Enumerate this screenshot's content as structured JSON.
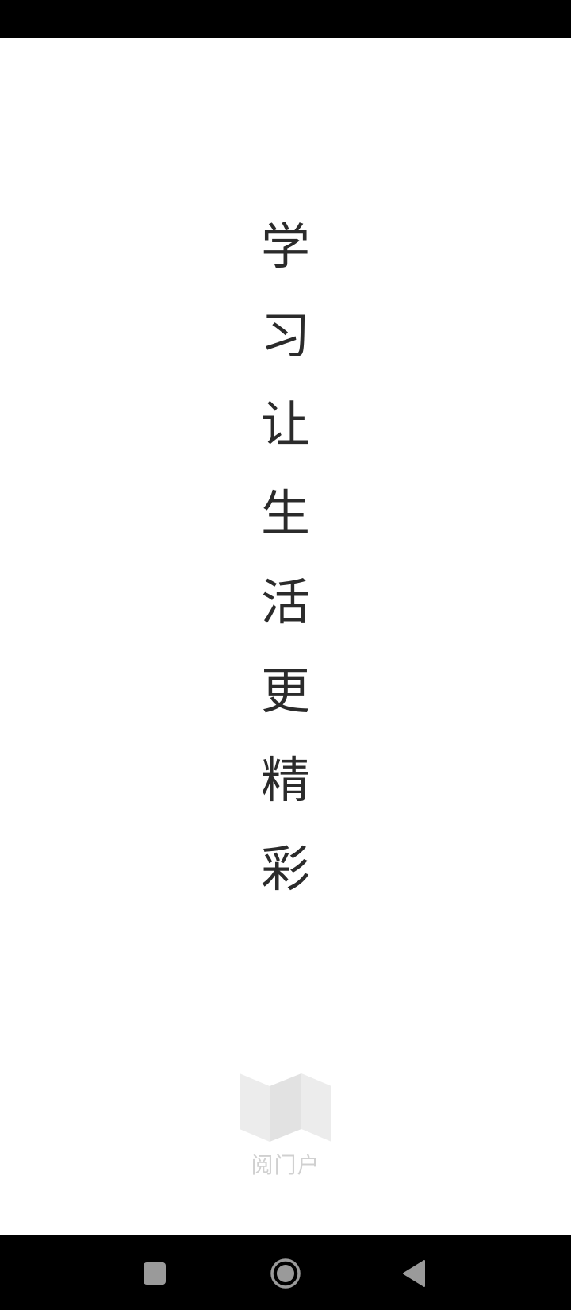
{
  "slogan": {
    "chars": [
      "学",
      "习",
      "让",
      "生",
      "活",
      "更",
      "精",
      "彩"
    ]
  },
  "brand": {
    "name": "阅门户",
    "logo_icon": "open-map-book-icon"
  },
  "navigation": {
    "recents_icon": "square-recents-icon",
    "home_icon": "circle-home-icon",
    "back_icon": "triangle-back-icon"
  },
  "colors": {
    "slogan_text": "#2b2b2b",
    "brand_text": "#d0d0d0",
    "system_bars": "#000000",
    "background": "#ffffff"
  }
}
